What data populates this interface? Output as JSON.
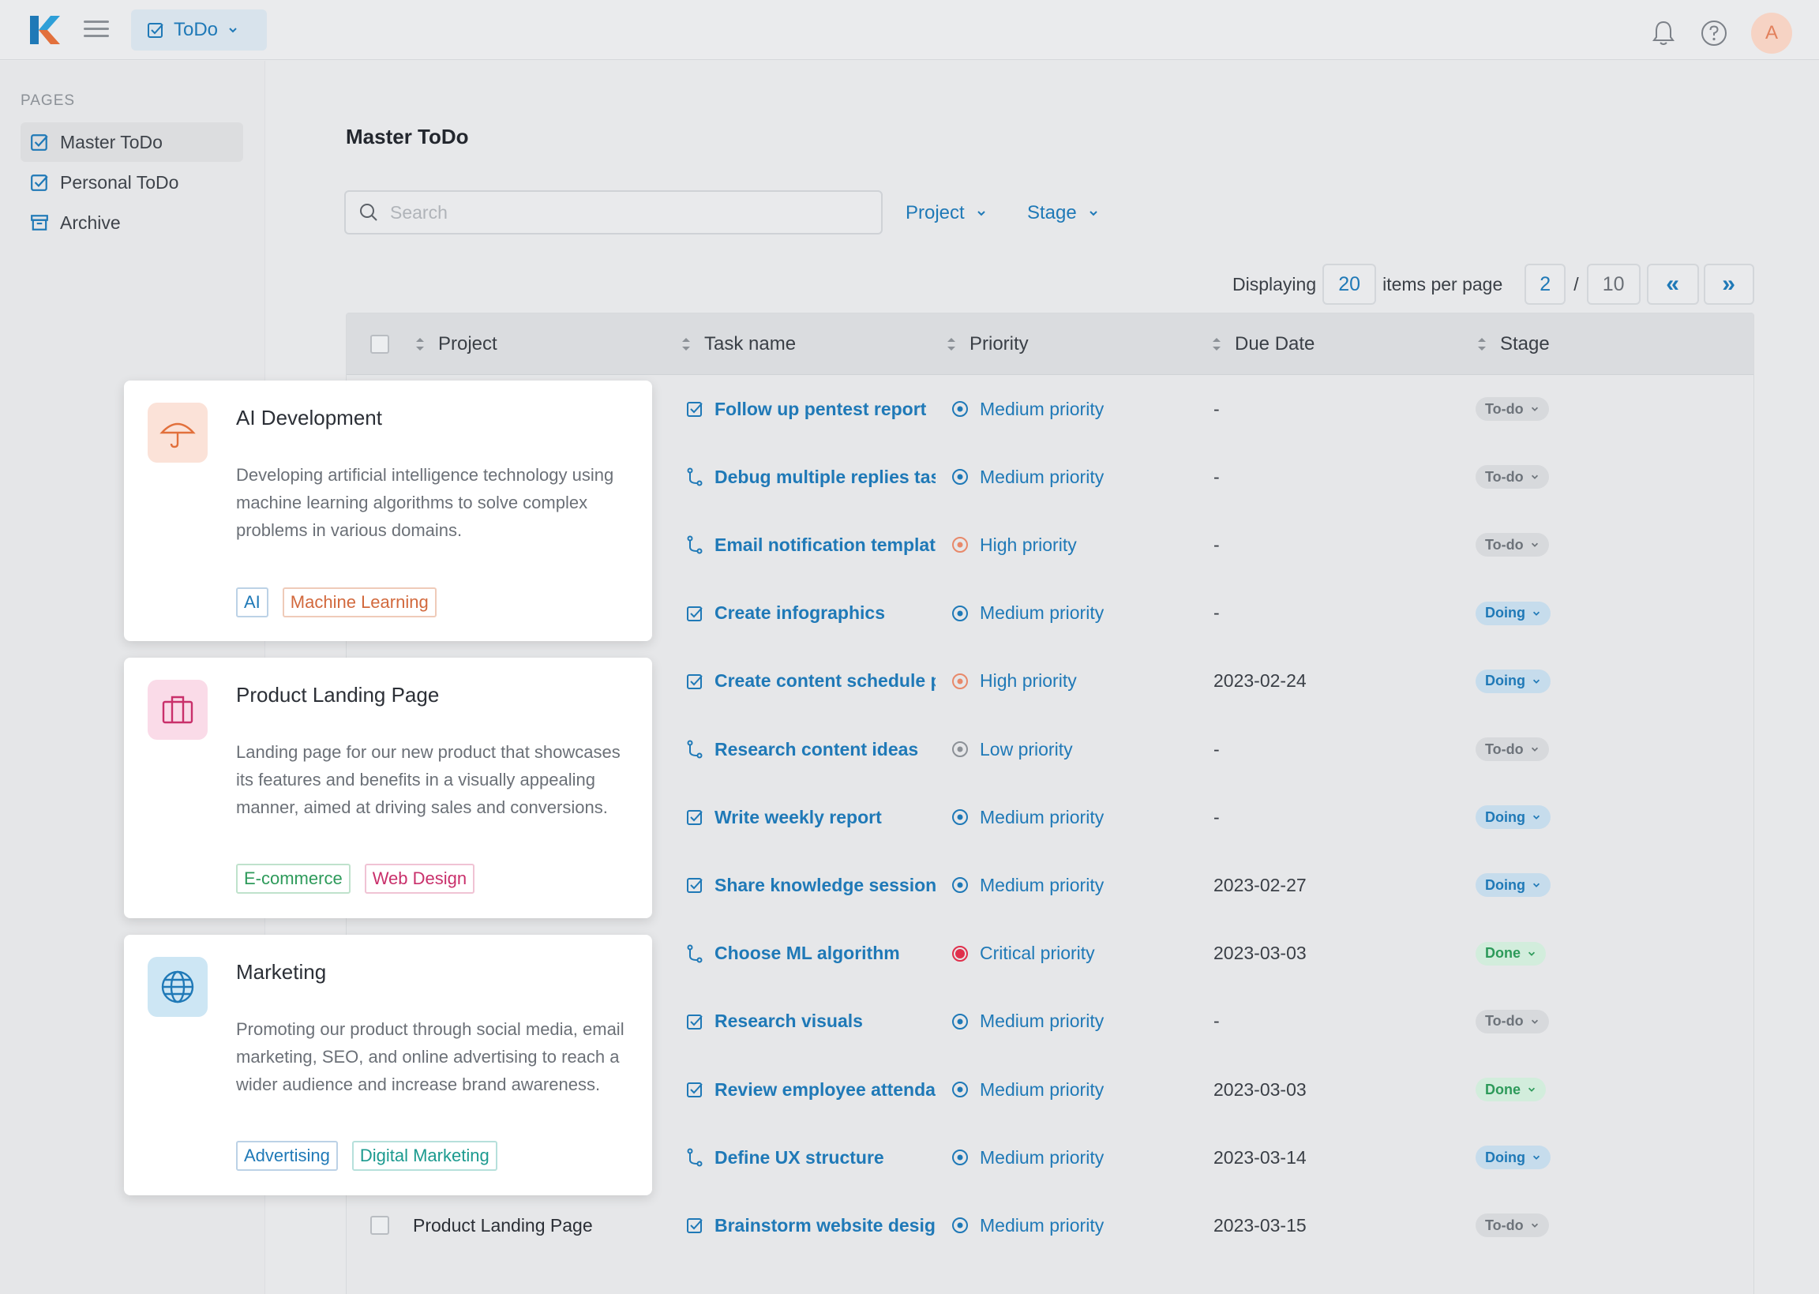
{
  "app": {
    "switcher_label": "ToDo",
    "avatar_initial": "A",
    "brand_color": "#1f79b7"
  },
  "sidebar": {
    "section_label": "PAGES",
    "items": [
      {
        "label": "Master ToDo",
        "icon": "checkbox-icon",
        "active": true
      },
      {
        "label": "Personal ToDo",
        "icon": "checkbox-icon",
        "active": false
      },
      {
        "label": "Archive",
        "icon": "archive-icon",
        "active": false
      }
    ]
  },
  "main": {
    "title": "Master ToDo",
    "search_placeholder": "Search",
    "filters": {
      "project": "Project",
      "stage": "Stage"
    },
    "pagination": {
      "displaying_label": "Displaying",
      "items_per_page": "20",
      "items_per_page_label": "items per page",
      "current_page": "2",
      "separator": "/",
      "total_pages": "10",
      "first_label": "«",
      "last_label": "»"
    },
    "columns": {
      "project": "Project",
      "task": "Task name",
      "priority": "Priority",
      "due": "Due Date",
      "stage": "Stage"
    },
    "rows": [
      {
        "project": "",
        "task": "Follow up pentest report",
        "task_icon": "checkbox-icon",
        "priority": "Medium priority",
        "priority_level": "medium",
        "due": "-",
        "stage": "To-do",
        "stage_kind": "todo"
      },
      {
        "project": "",
        "task": "Debug multiple replies tas",
        "task_icon": "branch-icon",
        "priority": "Medium priority",
        "priority_level": "medium",
        "due": "-",
        "stage": "To-do",
        "stage_kind": "todo"
      },
      {
        "project": "",
        "task": "Email notification templat",
        "task_icon": "branch-icon",
        "priority": "High priority",
        "priority_level": "high",
        "due": "-",
        "stage": "To-do",
        "stage_kind": "todo"
      },
      {
        "project": "",
        "task": "Create infographics",
        "task_icon": "checkbox-icon",
        "priority": "Medium priority",
        "priority_level": "medium",
        "due": "-",
        "stage": "Doing",
        "stage_kind": "doing"
      },
      {
        "project": "",
        "task": "Create content schedule p",
        "task_icon": "checkbox-icon",
        "priority": "High priority",
        "priority_level": "high",
        "due": "2023-02-24",
        "stage": "Doing",
        "stage_kind": "doing"
      },
      {
        "project": "",
        "task": "Research content ideas",
        "task_icon": "branch-icon",
        "priority": "Low priority",
        "priority_level": "low",
        "due": "-",
        "stage": "To-do",
        "stage_kind": "todo"
      },
      {
        "project": "",
        "task": "Write weekly report",
        "task_icon": "checkbox-icon",
        "priority": "Medium priority",
        "priority_level": "medium",
        "due": "-",
        "stage": "Doing",
        "stage_kind": "doing"
      },
      {
        "project": "",
        "task": "Share knowledge session",
        "task_icon": "checkbox-icon",
        "priority": "Medium priority",
        "priority_level": "medium",
        "due": "2023-02-27",
        "stage": "Doing",
        "stage_kind": "doing"
      },
      {
        "project": "",
        "task": "Choose ML algorithm",
        "task_icon": "branch-icon",
        "priority": "Critical priority",
        "priority_level": "critical",
        "due": "2023-03-03",
        "stage": "Done",
        "stage_kind": "done"
      },
      {
        "project": "",
        "task": "Research visuals",
        "task_icon": "checkbox-icon",
        "priority": "Medium priority",
        "priority_level": "medium",
        "due": "-",
        "stage": "To-do",
        "stage_kind": "todo"
      },
      {
        "project": "",
        "task": "Review employee attenda",
        "task_icon": "checkbox-icon",
        "priority": "Medium priority",
        "priority_level": "medium",
        "due": "2023-03-03",
        "stage": "Done",
        "stage_kind": "done"
      },
      {
        "project": "",
        "task": "Define UX structure",
        "task_icon": "branch-icon",
        "priority": "Medium priority",
        "priority_level": "medium",
        "due": "2023-03-14",
        "stage": "Doing",
        "stage_kind": "doing"
      },
      {
        "project": "Product Landing Page",
        "task": "Brainstorm website desig",
        "task_icon": "checkbox-icon",
        "priority": "Medium priority",
        "priority_level": "medium",
        "due": "2023-03-15",
        "stage": "To-do",
        "stage_kind": "todo"
      }
    ]
  },
  "cards": [
    {
      "title": "AI Development",
      "icon": "umbrella-icon",
      "description": "Developing artificial intelligence technology using machine learning algorithms to solve complex problems in various domains.",
      "tags": [
        {
          "label": "AI",
          "color": "#1f79b7"
        },
        {
          "label": "Machine Learning",
          "color": "#d2693d"
        }
      ]
    },
    {
      "title": "Product Landing Page",
      "icon": "briefcase-icon",
      "description": "Landing page for our new product that showcases its features and benefits in a visually appealing manner, aimed at driving sales and conversions.",
      "tags": [
        {
          "label": "E-commerce",
          "color": "#2d9a5a"
        },
        {
          "label": "Web Design",
          "color": "#c9306b"
        }
      ]
    },
    {
      "title": "Marketing",
      "icon": "globe-icon",
      "description": "Promoting our product through social media, email marketing, SEO, and online advertising to reach a wider audience and increase brand awareness.",
      "tags": [
        {
          "label": "Advertising",
          "color": "#1f79b7"
        },
        {
          "label": "Digital Marketing",
          "color": "#1b9a8f"
        }
      ]
    }
  ]
}
